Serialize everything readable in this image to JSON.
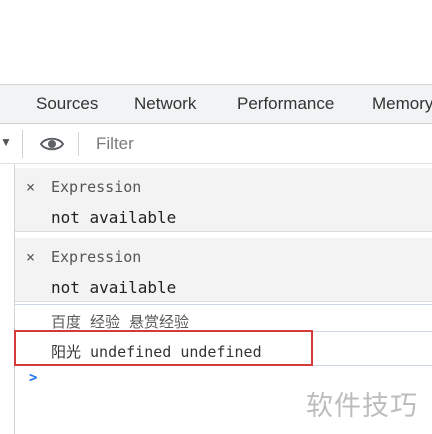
{
  "tabs": [
    "Sources",
    "Network",
    "Performance",
    "Memory"
  ],
  "toolbar": {
    "dropdown_arrow": "▼",
    "eye_icon": "eye-icon",
    "filter_placeholder": "Filter"
  },
  "expressions": [
    {
      "close": "×",
      "label": "Expression",
      "value": "not available"
    },
    {
      "close": "×",
      "label": "Expression",
      "value": "not available"
    }
  ],
  "console": {
    "message_1": "百度 经验 悬赏经验",
    "message_2": "阳光 undefined undefined",
    "prompt": ">"
  },
  "highlight_color": "#d53a3a",
  "watermark": "软件技巧"
}
